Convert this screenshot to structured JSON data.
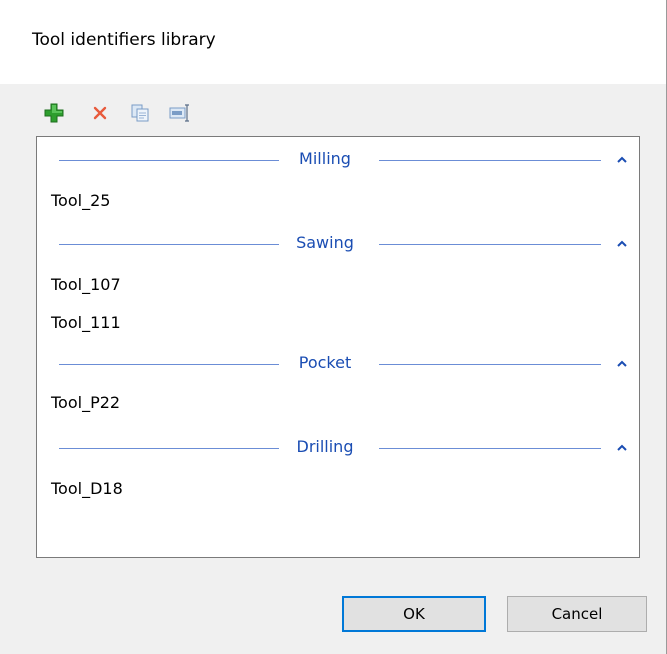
{
  "window": {
    "title": "Tool identifiers library"
  },
  "toolbar": {
    "add_icon": "add-icon",
    "delete_icon": "delete-icon",
    "copy_icon": "copy-icon",
    "rename_icon": "rename-icon"
  },
  "groups": [
    {
      "title": "Milling",
      "items": [
        "Tool_25"
      ]
    },
    {
      "title": "Sawing",
      "items": [
        "Tool_107",
        "Tool_111"
      ]
    },
    {
      "title": "Pocket",
      "items": [
        "Tool_P22"
      ]
    },
    {
      "title": "Drilling",
      "items": [
        "Tool_D18"
      ]
    }
  ],
  "buttons": {
    "ok": "OK",
    "cancel": "Cancel"
  },
  "colors": {
    "group_title": "#1a4db3",
    "group_line": "#6b8dd6",
    "add_green": "#2e9e2e",
    "delete_red": "#e85a3c",
    "ok_border": "#0078d7"
  }
}
